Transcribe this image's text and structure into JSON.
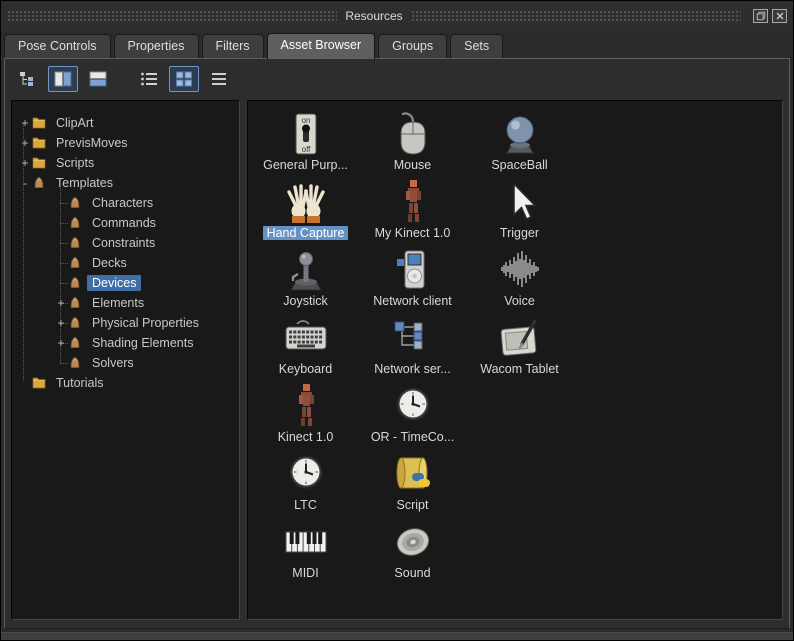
{
  "window": {
    "title": "Resources"
  },
  "window_controls": [
    {
      "name": "float-window",
      "icon": "restore"
    },
    {
      "name": "close-window",
      "icon": "close"
    }
  ],
  "tabs": {
    "items": [
      {
        "label": "Pose Controls",
        "active": false
      },
      {
        "label": "Properties",
        "active": false
      },
      {
        "label": "Filters",
        "active": false
      },
      {
        "label": "Asset Browser",
        "active": true
      },
      {
        "label": "Groups",
        "active": false
      },
      {
        "label": "Sets",
        "active": false
      }
    ]
  },
  "toolbar": {
    "buttons": [
      {
        "name": "tree-view",
        "icon": "tree-view",
        "pressed": false
      },
      {
        "name": "split-vertical-view",
        "icon": "split-vertical",
        "pressed": true
      },
      {
        "name": "split-horizontal-view",
        "icon": "split-horizontal",
        "pressed": false
      },
      {
        "name": "list-view",
        "icon": "list-view",
        "pressed": false
      },
      {
        "name": "icon-view",
        "icon": "grid-view",
        "pressed": true
      },
      {
        "name": "detail-view",
        "icon": "detail-view",
        "pressed": false
      }
    ]
  },
  "tree": {
    "items": [
      {
        "label": "ClipArt",
        "icon": "folder",
        "expander": "+",
        "depth": 0,
        "selected": false
      },
      {
        "label": "PrevisMoves",
        "icon": "folder",
        "expander": "+",
        "depth": 0,
        "selected": false
      },
      {
        "label": "Scripts",
        "icon": "folder",
        "expander": "+",
        "depth": 0,
        "selected": false
      },
      {
        "label": "Templates",
        "icon": "template",
        "expander": "-",
        "depth": 0,
        "selected": false
      },
      {
        "label": "Characters",
        "icon": "template",
        "expander": null,
        "depth": 1,
        "selected": false
      },
      {
        "label": "Commands",
        "icon": "template",
        "expander": null,
        "depth": 1,
        "selected": false
      },
      {
        "label": "Constraints",
        "icon": "template",
        "expander": null,
        "depth": 1,
        "selected": false
      },
      {
        "label": "Decks",
        "icon": "template",
        "expander": null,
        "depth": 1,
        "selected": false
      },
      {
        "label": "Devices",
        "icon": "template",
        "expander": null,
        "depth": 1,
        "selected": true
      },
      {
        "label": "Elements",
        "icon": "template",
        "expander": "+",
        "depth": 1,
        "selected": false
      },
      {
        "label": "Physical Properties",
        "icon": "template",
        "expander": "+",
        "depth": 1,
        "selected": false
      },
      {
        "label": "Shading Elements",
        "icon": "template",
        "expander": "+",
        "depth": 1,
        "selected": false
      },
      {
        "label": "Solvers",
        "icon": "template",
        "expander": null,
        "depth": 1,
        "selected": false
      },
      {
        "label": "Tutorials",
        "icon": "folder",
        "expander": null,
        "depth": 0,
        "selected": false
      }
    ]
  },
  "assets": {
    "items": [
      {
        "label": "General Purp...",
        "icon": "switch",
        "selected": false
      },
      {
        "label": "Mouse",
        "icon": "mouse",
        "selected": false
      },
      {
        "label": "SpaceBall",
        "icon": "spaceball",
        "selected": false
      },
      {
        "label": "Hand Capture",
        "icon": "hands",
        "selected": true
      },
      {
        "label": "My Kinect 1.0",
        "icon": "kinect",
        "selected": false
      },
      {
        "label": "Trigger",
        "icon": "cursor",
        "selected": false
      },
      {
        "label": "Joystick",
        "icon": "joystick",
        "selected": false
      },
      {
        "label": "Network client",
        "icon": "media-player",
        "selected": false
      },
      {
        "label": "Voice",
        "icon": "waveform",
        "selected": false
      },
      {
        "label": "Keyboard",
        "icon": "keyboard",
        "selected": false
      },
      {
        "label": "Network ser...",
        "icon": "network",
        "selected": false
      },
      {
        "label": "Wacom Tablet",
        "icon": "tablet",
        "selected": false
      },
      {
        "label": "Kinect 1.0",
        "icon": "kinect",
        "selected": false
      },
      {
        "label": "OR - TimeCo...",
        "icon": "clock",
        "selected": false
      },
      {
        "label": "LTC",
        "icon": "clock",
        "selected": false
      },
      {
        "label": "Script",
        "icon": "script",
        "selected": false
      },
      {
        "label": "MIDI",
        "icon": "midi",
        "selected": false
      },
      {
        "label": "Sound",
        "icon": "speaker",
        "selected": false
      }
    ]
  },
  "colors": {
    "tree_selection_bg": "#3f6fa6",
    "asset_selection_bg": "#6592c6",
    "accent": "#7fa3d0",
    "folder": "#d9a83f"
  }
}
